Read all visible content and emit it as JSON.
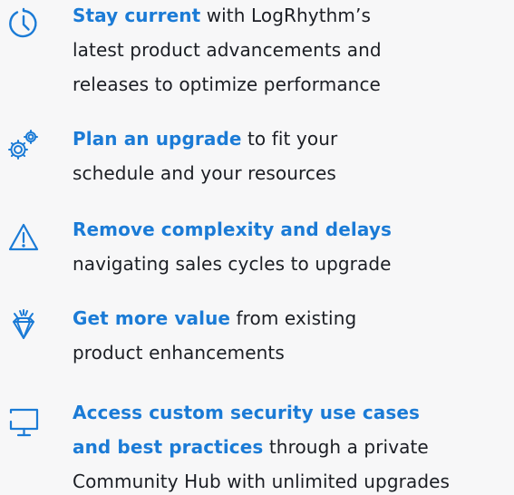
{
  "items": [
    {
      "icon": "clock-icon",
      "lines": [
        {
          "bold": "Stay current",
          "rest": " with LogRhythm’s"
        },
        {
          "bold": "",
          "rest": "latest product advancements and"
        },
        {
          "bold": "",
          "rest": "releases to optimize performance"
        }
      ]
    },
    {
      "icon": "gears-icon",
      "lines": [
        {
          "bold": "Plan an upgrade",
          "rest": " to fit your"
        },
        {
          "bold": "",
          "rest": "schedule and your resources"
        }
      ]
    },
    {
      "icon": "warning-icon",
      "lines": [
        {
          "bold": "Remove complexity and delays",
          "rest": ""
        },
        {
          "bold": "",
          "rest": "navigating sales cycles to upgrade"
        }
      ]
    },
    {
      "icon": "diamond-icon",
      "lines": [
        {
          "bold": "Get more value",
          "rest": " from existing"
        },
        {
          "bold": "",
          "rest": "product enhancements"
        }
      ]
    },
    {
      "icon": "monitor-icon",
      "lines": [
        {
          "bold": "Access custom security use cases",
          "rest": ""
        },
        {
          "bold": "and best practices",
          "rest": " through a private"
        },
        {
          "bold": "",
          "rest": "Community Hub with unlimited upgrades"
        }
      ]
    }
  ],
  "colors": {
    "accent": "#1b7bd6",
    "text": "#1b1e24",
    "background": "#f7f7f8"
  }
}
